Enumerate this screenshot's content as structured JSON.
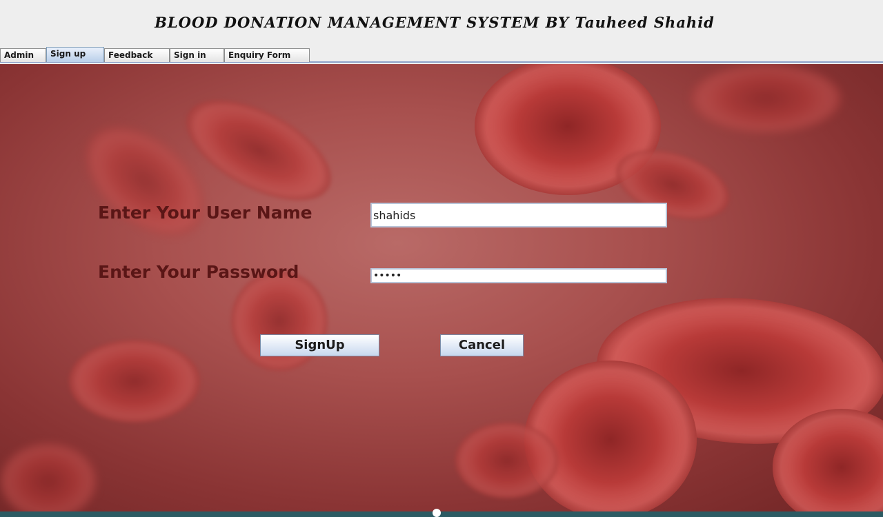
{
  "window": {
    "title": "BLOOD DONATION MANAGEMENT SYSTEM BY Tauheed Shahid"
  },
  "tabs": [
    {
      "label": "Admin",
      "active": false
    },
    {
      "label": "Sign up",
      "active": true
    },
    {
      "label": "Feedback",
      "active": false
    },
    {
      "label": "Sign in",
      "active": false
    },
    {
      "label": "Enquiry Form",
      "active": false
    }
  ],
  "form": {
    "username_label": "Enter Your User Name",
    "username_value": "shahids",
    "password_label": "Enter Your Password",
    "password_value": "•••••",
    "signup_label": "SignUp",
    "cancel_label": "Cancel"
  },
  "colors": {
    "label_text": "#5a1616",
    "tab_active": "#b9cfe9",
    "background_theme": "red blood cells"
  }
}
